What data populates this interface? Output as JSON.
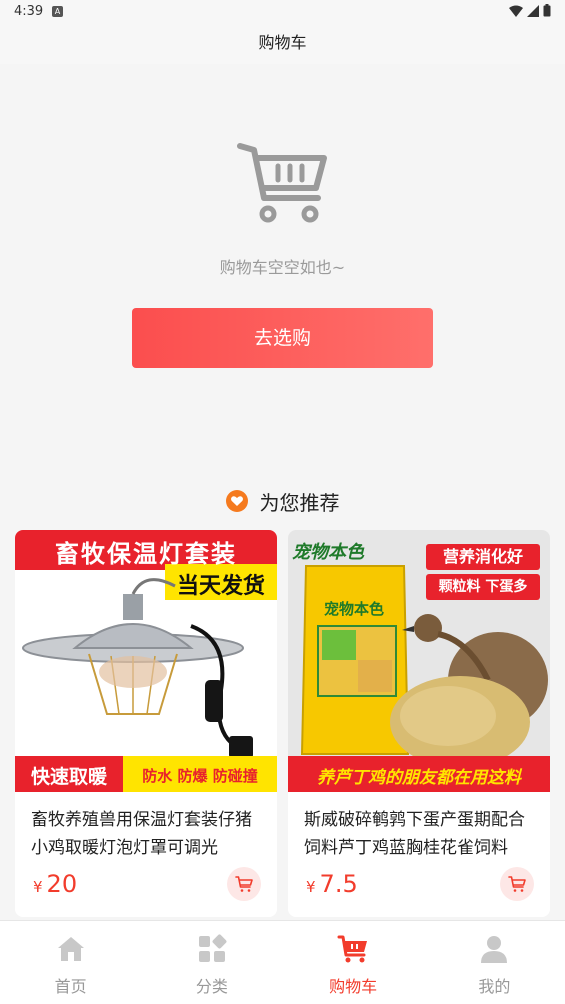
{
  "status_bar": {
    "time": "4:39"
  },
  "header": {
    "title": "购物车"
  },
  "empty_cart": {
    "message": "购物车空空如也~",
    "button_label": "去选购"
  },
  "recommend": {
    "title": "为您推荐",
    "products": [
      {
        "name": "畜牧养殖兽用保温灯套装仔猪小鸡取暖灯泡灯罩可调光",
        "currency": "¥",
        "price": "20",
        "banner_top": "畜牧保温灯套装",
        "banner_tag": "当天发货",
        "banner_bottom_left": "快速取暖",
        "banner_bottom_right": "防水 防爆 防碰撞"
      },
      {
        "name": "斯威破碎鹌鹑下蛋产蛋期配合饲料芦丁鸡蓝胸桂花雀饲料",
        "currency": "¥",
        "price": "7.5",
        "brand": "宠物本色",
        "tag1": "营养消化好",
        "tag2": "颗粒料 下蛋多",
        "banner_bottom": "养芦丁鸡的朋友都在用这料"
      }
    ]
  },
  "tabs": [
    {
      "label": "首页",
      "icon": "home-icon"
    },
    {
      "label": "分类",
      "icon": "category-icon"
    },
    {
      "label": "购物车",
      "icon": "cart-icon",
      "active": true
    },
    {
      "label": "我的",
      "icon": "user-icon"
    }
  ],
  "colors": {
    "accent": "#f23c2c",
    "button_start": "#fb4e4e",
    "button_end": "#ff6f6b"
  }
}
